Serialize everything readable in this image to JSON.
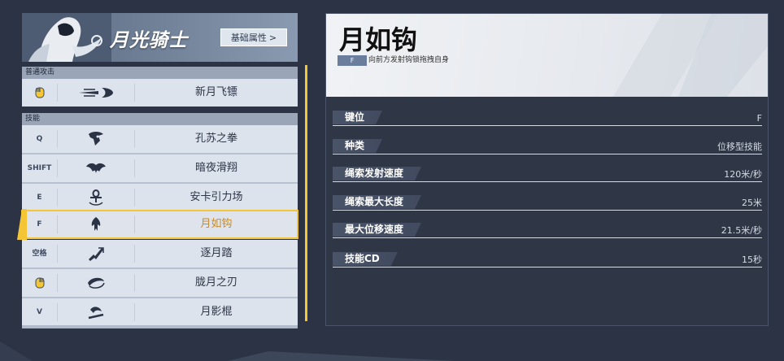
{
  "hero": {
    "name": "月光骑士",
    "attr_button": "基础属性",
    "attr_chevron": ">"
  },
  "basic_attack": {
    "section_label": "普通攻击",
    "items": [
      {
        "key": "",
        "key_icon": "mouse-icon",
        "name": "新月飞镖",
        "icon": "crescent-dart-icon"
      }
    ]
  },
  "skills": {
    "section_label": "技能",
    "items": [
      {
        "key": "Q",
        "name": "孔苏之拳",
        "icon": "bird-skull-icon"
      },
      {
        "key": "SHIFT",
        "name": "暗夜滑翔",
        "icon": "glide-wings-icon"
      },
      {
        "key": "E",
        "name": "安卡引力场",
        "icon": "ankh-icon"
      },
      {
        "key": "F",
        "name": "月如钩",
        "icon": "moon-hook-icon"
      },
      {
        "key": "空格",
        "name": "逐月踏",
        "icon": "leap-icon"
      },
      {
        "key": "",
        "key_icon": "mouse-icon",
        "name": "胧月之刃",
        "icon": "crescent-blade-icon"
      },
      {
        "key": "V",
        "name": "月影棍",
        "icon": "moon-staff-icon"
      }
    ],
    "active_index": 3
  },
  "detail": {
    "title": "月如钩",
    "key_badge": "F",
    "description": "向前方发射钩锁拖拽自身",
    "stats": [
      {
        "label": "键位",
        "value": "F"
      },
      {
        "label": "种类",
        "value": "位移型技能"
      },
      {
        "label": "绳索发射速度",
        "value": "120米/秒"
      },
      {
        "label": "绳索最大长度",
        "value": "25米"
      },
      {
        "label": "最大位移速度",
        "value": "21.5米/秒"
      },
      {
        "label": "技能CD",
        "value": "15秒"
      }
    ]
  },
  "colors": {
    "accent_yellow": "#f4c534",
    "active_text": "#c58a2a",
    "background": "#2b3344"
  }
}
